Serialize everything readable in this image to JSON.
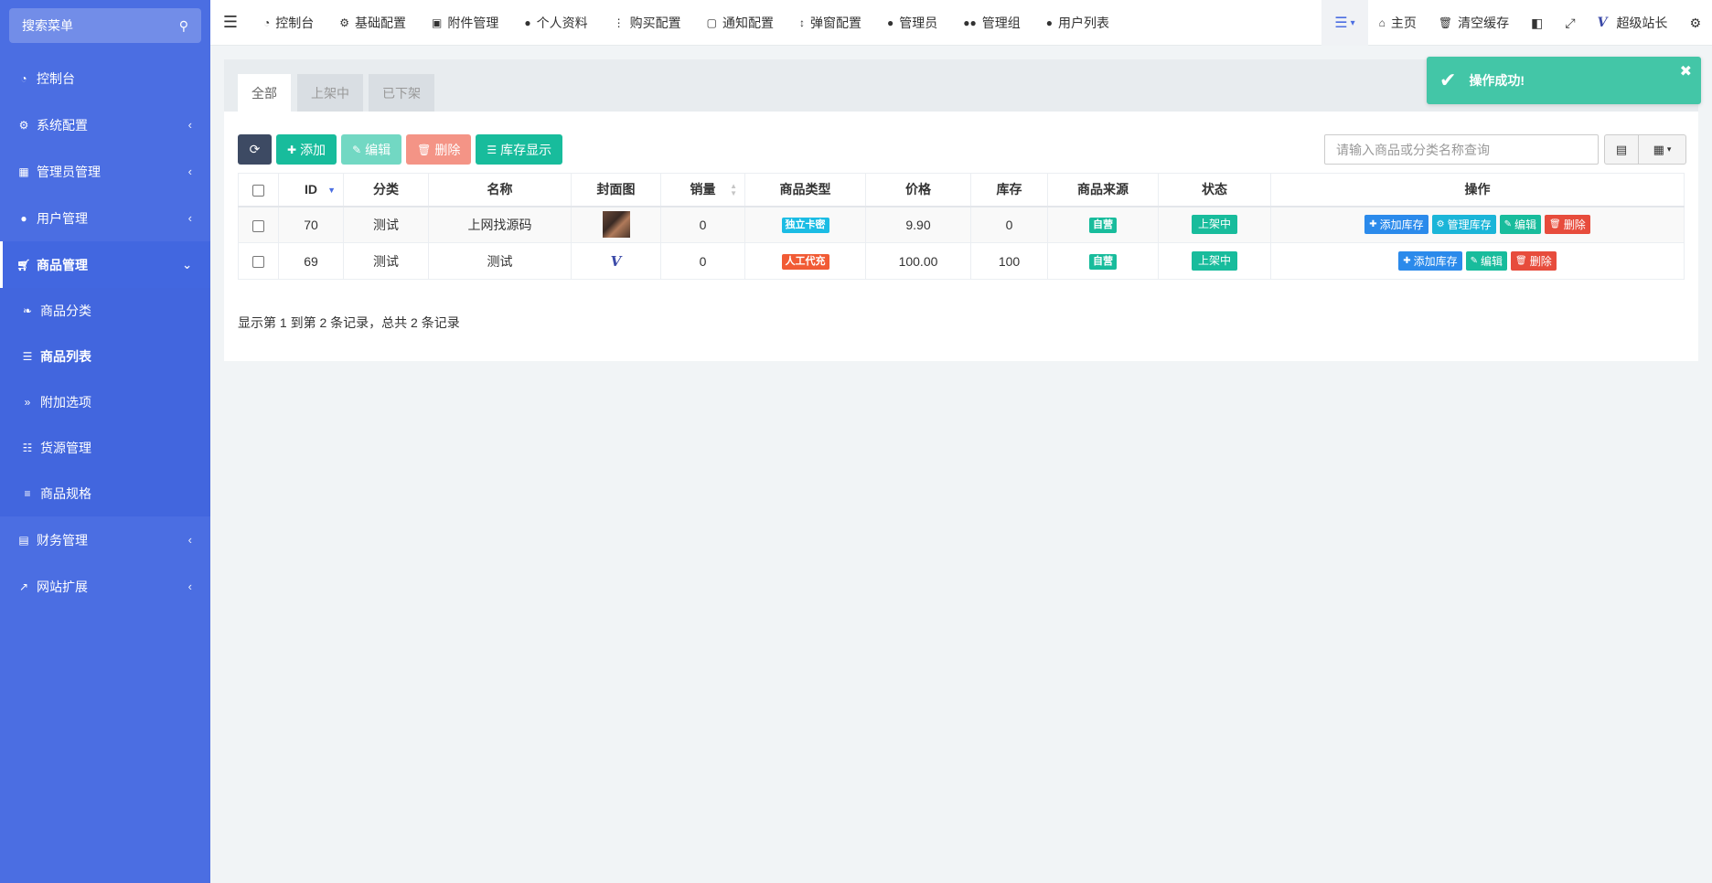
{
  "sidebar": {
    "search_placeholder": "搜索菜单",
    "items": [
      {
        "label": "控制台",
        "icon": "dashboard-icon"
      },
      {
        "label": "系统配置",
        "icon": "cogs-icon"
      },
      {
        "label": "管理员管理",
        "icon": "windows-icon"
      },
      {
        "label": "用户管理",
        "icon": "user-icon"
      },
      {
        "label": "商品管理",
        "icon": "cart-icon"
      },
      {
        "label": "财务管理",
        "icon": "ledger-icon"
      },
      {
        "label": "网站扩展",
        "icon": "external-link-icon"
      }
    ],
    "submenu": [
      {
        "label": "商品分类",
        "icon": "leaf-icon"
      },
      {
        "label": "商品列表",
        "icon": "list-icon"
      },
      {
        "label": "附加选项",
        "icon": "double-angle-icon"
      },
      {
        "label": "货源管理",
        "icon": "sitemap-icon"
      },
      {
        "label": "商品规格",
        "icon": "sliders-icon"
      }
    ]
  },
  "topnav": {
    "links": [
      {
        "label": "控制台",
        "icon": "dashboard-icon"
      },
      {
        "label": "基础配置",
        "icon": "cog-icon"
      },
      {
        "label": "附件管理",
        "icon": "file-image-icon"
      },
      {
        "label": "个人资料",
        "icon": "user-icon"
      },
      {
        "label": "购买配置",
        "icon": "ellipsis-v-icon"
      },
      {
        "label": "通知配置",
        "icon": "twitch-icon"
      },
      {
        "label": "弹窗配置",
        "icon": "sort-icon"
      },
      {
        "label": "管理员",
        "icon": "user-icon"
      },
      {
        "label": "管理组",
        "icon": "users-icon"
      },
      {
        "label": "用户列表",
        "icon": "user-icon"
      }
    ],
    "right": {
      "home": "主页",
      "clear_cache": "清空缓存",
      "user": "超级站长"
    }
  },
  "tabs": [
    "全部",
    "上架中",
    "已下架"
  ],
  "toolbar": {
    "add": "添加",
    "edit": "编辑",
    "delete": "删除",
    "stock": "库存显示"
  },
  "search": {
    "placeholder": "请输入商品或分类名称查询"
  },
  "table": {
    "headers": [
      "ID",
      "分类",
      "名称",
      "封面图",
      "销量",
      "商品类型",
      "价格",
      "库存",
      "商品来源",
      "状态",
      "操作"
    ],
    "rows": [
      {
        "id": "70",
        "category": "测试",
        "name": "上网找源码",
        "sales": "0",
        "type": "独立卡密",
        "price": "9.90",
        "stock": "0",
        "source": "自营",
        "status": "上架中",
        "actions": [
          "添加库存",
          "管理库存",
          "编辑",
          "删除"
        ]
      },
      {
        "id": "69",
        "category": "测试",
        "name": "测试",
        "sales": "0",
        "type": "人工代充",
        "price": "100.00",
        "stock": "100",
        "source": "自营",
        "status": "上架中",
        "actions": [
          "添加库存",
          "编辑",
          "删除"
        ]
      }
    ]
  },
  "pagination_info": "显示第 1 到第 2 条记录，总共 2 条记录",
  "toast": {
    "message": "操作成功!"
  },
  "colors": {
    "sidebar": "#4b6ee2",
    "success": "#18bc9c",
    "danger": "#e74c3c",
    "primary": "#2b8aeb"
  }
}
